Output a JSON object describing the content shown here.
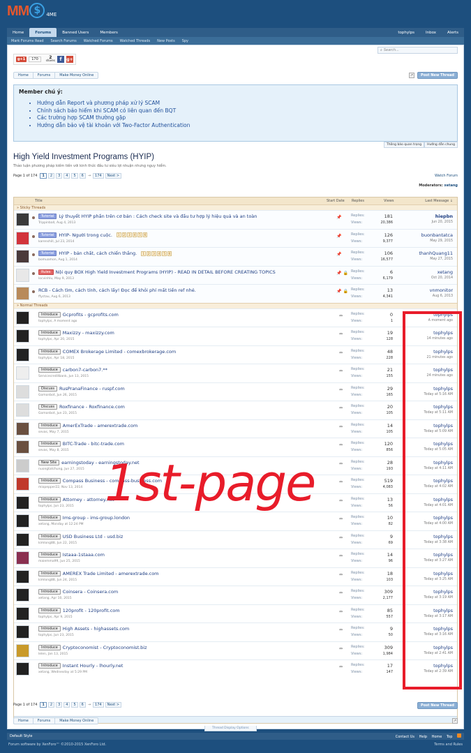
{
  "logo": {
    "m1": "MM",
    "coin": "$",
    "suffix": "4ME"
  },
  "nav": {
    "tabs": [
      "Home",
      "Forums",
      "Banned Users",
      "Members"
    ],
    "right": [
      "tophylps",
      "Inbox",
      "Alerts"
    ],
    "sub": [
      "Mark Forums Read",
      "Search Forums",
      "Watched Forums",
      "Watched Threads",
      "New Posts",
      "Spy"
    ]
  },
  "search": {
    "placeholder": "Search..."
  },
  "share": {
    "gplus": "g+1",
    "count": "170",
    "shares_num": "2",
    "shares_lbl": "shares",
    "fb": "f",
    "gp": "g+"
  },
  "breadcrumb": [
    "Home",
    "Forums",
    "Make Money Online"
  ],
  "post_new_thread": "Post New Thread",
  "notice": {
    "title": "Member chú ý:",
    "items": [
      "Hướng dẫn Report và phương pháp xử lý SCAM",
      "Chính sách bảo hiểm khi SCAM có liên quan đến BQT",
      "Các trường hợp SCAM thường gặp",
      "Hướng dẫn bảo vệ tài khoản với Two-Factor Authentication"
    ],
    "tabs": [
      "Thông báo quan trọng",
      "Hướng dẫn chung"
    ]
  },
  "forum": {
    "title": "High Yield Investment Programs (HYIP)",
    "desc": "Thảo luận phương pháp kiếm tiền với kinh thức đầu tư siêu lợi nhuận nhưng nguy hiểm.",
    "page_label": "Page 1 of 174",
    "pages": [
      "1",
      "2",
      "3",
      "4",
      "5",
      "6"
    ],
    "arrow": "→",
    "last_page": "174",
    "next": "Next >",
    "watch": "Watch Forum",
    "mods_label": "Moderators:",
    "mods": "xetang"
  },
  "table": {
    "headers": {
      "title": "Title",
      "start": "Start Date",
      "replies": "Replies",
      "views": "Views",
      "last": "Last Message ↓"
    },
    "sticky_label": "» Sticky Threads",
    "normal_label": "» Normal Threads",
    "replies_lbl": "Replies:",
    "views_lbl": "Views:",
    "footer": "Showing threads 1 to 20 of 3,470",
    "display_options": "Thread Display Options",
    "sticky": [
      {
        "prefix": "Tutorial",
        "ptype": "tut",
        "title": "Lý thuyết HYIP phần trên cơ bản : Cách check site và đầu tư hợp lý hiệu quả và an toàn",
        "author": "Trippinball",
        "date": "Aug 4, 2013",
        "replies": "181",
        "views": "20,386",
        "last_user": "hiepbn",
        "last_date": "Jun 20, 2015",
        "pages": [],
        "avatar": "#3a3a3a",
        "icons": [
          "pin"
        ],
        "bold_last": true
      },
      {
        "prefix": "Tutorial",
        "ptype": "tut",
        "title": "HYIP- Người trong cuộc.",
        "author": "karenshill",
        "date": "Jul 23, 2014",
        "replies": "126",
        "views": "9,377",
        "last_user": "buonbantatca",
        "last_date": "May 29, 2015",
        "pages": [
          "1",
          "2",
          "3",
          "4",
          "5",
          "6"
        ],
        "avatar": "#d2343b",
        "icons": [
          "pin"
        ],
        "bold_last": false
      },
      {
        "prefix": "Tutorial",
        "ptype": "tut",
        "title": "HYIP - bản chất, cách chiến thắng.",
        "author": "bomuamon",
        "date": "Aug 1, 2014",
        "replies": "106",
        "views": "16,577",
        "last_user": "thanhQuang11",
        "last_date": "May 27, 2015",
        "pages": [
          "1",
          "2",
          "3",
          "4",
          "5",
          "6"
        ],
        "avatar": "#4a3a3a",
        "icons": [
          "pin"
        ],
        "bold_last": false
      },
      {
        "prefix": "Rules",
        "ptype": "rules",
        "title": "Nội quy BOX High Yield Investment Programs (HYIP) - READ IN DETAIL BEFORE CREATING TOPICS",
        "author": "locvinhlu",
        "date": "May 9, 2013",
        "replies": "6",
        "views": "6,179",
        "last_user": "xetang",
        "last_date": "Oct 20, 2014",
        "pages": [],
        "avatar": "#e8e8e8",
        "icons": [
          "pin",
          "lock"
        ],
        "bold_last": false
      },
      {
        "prefix": "",
        "ptype": "",
        "title": "RCB - Cách tìm, cách tính, cách lấy! Đọc để khỏi phí mất tiền ref nhé.",
        "author": "ffyctau",
        "date": "Aug 6, 2013",
        "replies": "13",
        "views": "4,341",
        "last_user": "vnmonitor",
        "last_date": "Aug 6, 2013",
        "pages": [],
        "avatar": "#b88a5a",
        "icons": [
          "pin",
          "lock"
        ],
        "bold_last": false
      }
    ],
    "normal": [
      {
        "prefix": "Introduce",
        "title": "Gcprofits - gcprofits.com",
        "author": "tophylps",
        "date": "A moment ago",
        "replies": "0",
        "views": "1",
        "last_user": "tophylps",
        "last_date": "A moment ago",
        "avatar": "#222"
      },
      {
        "prefix": "Introduce",
        "title": "Maxizzy - maxizzy.com",
        "author": "tophylps",
        "date": "Apr 20, 2015",
        "replies": "19",
        "views": "128",
        "last_user": "tophylps",
        "last_date": "14 minutes ago",
        "avatar": "#222"
      },
      {
        "prefix": "Introduce",
        "title": "COMEX Brokerage Limited - comexbrokerage.com",
        "author": "tophylps",
        "date": "Apr 18, 2015",
        "replies": "48",
        "views": "228",
        "last_user": "tophylps",
        "last_date": "21 minutes ago",
        "avatar": "#222"
      },
      {
        "prefix": "Introduce",
        "title": "carbon7-carbon7.**",
        "author": "Servicecreditbank",
        "date": "Jun 13, 2015",
        "replies": "21",
        "views": "155",
        "last_user": "tophylps",
        "last_date": "24 minutes ago",
        "avatar": "#eee"
      },
      {
        "prefix": "Discuss",
        "title": "RusPranaFinance - ruspf.com",
        "author": "Gomonbot",
        "date": "Jun 26, 2015",
        "replies": "29",
        "views": "165",
        "last_user": "tophylps",
        "last_date": "Today at 5:16 AM",
        "avatar": "#ddd"
      },
      {
        "prefix": "Discuss",
        "title": "Roxfinance - Roxfinance.com",
        "author": "Gomonbot",
        "date": "Jun 23, 2015",
        "replies": "20",
        "views": "105",
        "last_user": "tophylps",
        "last_date": "Today at 5:11 AM",
        "avatar": "#ddd"
      },
      {
        "prefix": "Introduce",
        "title": "AmerExTrade - amerextrade.com",
        "author": "sevas",
        "date": "May 7, 2015",
        "replies": "14",
        "views": "105",
        "last_user": "tophylps",
        "last_date": "Today at 5:09 AM",
        "avatar": "#6a5040"
      },
      {
        "prefix": "Introduce",
        "title": "BITC-Trade - bitc-trade.com",
        "author": "sevas",
        "date": "May 8, 2015",
        "replies": "120",
        "views": "856",
        "last_user": "tophylps",
        "last_date": "Today at 5:05 AM",
        "avatar": "#6a5040"
      },
      {
        "prefix": "New Site",
        "title": "earningstoday - earningstoday.net",
        "author": "nuongtatchung",
        "date": "Jun 27, 2015",
        "replies": "28",
        "views": "193",
        "last_user": "tophylps",
        "last_date": "Today at 4:11 AM",
        "avatar": "#ccc"
      },
      {
        "prefix": "Introduce",
        "title": "Compass Business - compass-business.com",
        "author": "miopepper22",
        "date": "Nov 13, 2014",
        "replies": "519",
        "views": "4,083",
        "last_user": "tophylps",
        "last_date": "Today at 4:02 AM",
        "avatar": "#c0392b"
      },
      {
        "prefix": "Introduce",
        "title": "Attorney - attorney.net",
        "author": "tophylps",
        "date": "Jun 23, 2015",
        "replies": "13",
        "views": "56",
        "last_user": "tophylps",
        "last_date": "Today at 4:01 AM",
        "avatar": "#222"
      },
      {
        "prefix": "Introduce",
        "title": "Ims-group - ims-group.london",
        "author": "xetang",
        "date": "Monday at 12:24 PM",
        "replies": "10",
        "views": "82",
        "last_user": "tophylps",
        "last_date": "Today at 4:00 AM",
        "avatar": "#222"
      },
      {
        "prefix": "Introduce",
        "title": "USD Business Ltd - usd.biz",
        "author": "kimlong88",
        "date": "Jun 22, 2015",
        "replies": "9",
        "views": "69",
        "last_user": "tophylps",
        "last_date": "Today at 3:38 AM",
        "avatar": "#222"
      },
      {
        "prefix": "Introduce",
        "title": "Istaaa-1staaa.com",
        "author": "maiemma99",
        "date": "Jun 25, 2015",
        "replies": "14",
        "views": "96",
        "last_user": "tophylps",
        "last_date": "Today at 3:27 AM",
        "avatar": "#8a3050"
      },
      {
        "prefix": "Introduce",
        "title": "AMEREX Trade Limited - amerextrade.com",
        "author": "kimlong88",
        "date": "Jun 24, 2015",
        "replies": "18",
        "views": "103",
        "last_user": "tophylps",
        "last_date": "Today at 3:25 AM",
        "avatar": "#222"
      },
      {
        "prefix": "Introduce",
        "title": "Coinsera - Coinsera.com",
        "author": "xetang",
        "date": "Apr 10, 2015",
        "replies": "309",
        "views": "2,177",
        "last_user": "tophylps",
        "last_date": "Today at 3:19 AM",
        "avatar": "#222"
      },
      {
        "prefix": "Introduce",
        "title": "120profit - 120profit.com",
        "author": "tophylps",
        "date": "Apr 9, 2015",
        "replies": "85",
        "views": "557",
        "last_user": "tophylps",
        "last_date": "Today at 3:17 AM",
        "avatar": "#222"
      },
      {
        "prefix": "Introduce",
        "title": "High Assets - highassets.com",
        "author": "tophylps",
        "date": "Jun 23, 2015",
        "replies": "9",
        "views": "50",
        "last_user": "tophylps",
        "last_date": "Today at 3:16 AM",
        "avatar": "#222"
      },
      {
        "prefix": "Introduce",
        "title": "Cryptoconomist - Cryptoconomist.biz",
        "author": "lelen",
        "date": "Jan 13, 2015",
        "replies": "309",
        "views": "1,984",
        "last_user": "tophylps",
        "last_date": "Today at 2:41 AM",
        "avatar": "#c99a2a"
      },
      {
        "prefix": "Introduce",
        "title": "Instant Hourly - lhourly.net",
        "author": "xetang",
        "date": "Wednesday at 5:29 PM",
        "replies": "17",
        "views": "147",
        "last_user": "tophylps",
        "last_date": "Today at 2:39 AM",
        "avatar": "#222"
      }
    ]
  },
  "annotation": {
    "text": "1st-page",
    "color": "#e81c2a"
  },
  "footer": {
    "style": "Default Style",
    "links": [
      "Contact Us",
      "Help",
      "Home",
      "Top"
    ],
    "copyright": "Forum software by XenForo™ ©2010-2015 XenForo Ltd.",
    "terms": "Terms and Rules"
  }
}
